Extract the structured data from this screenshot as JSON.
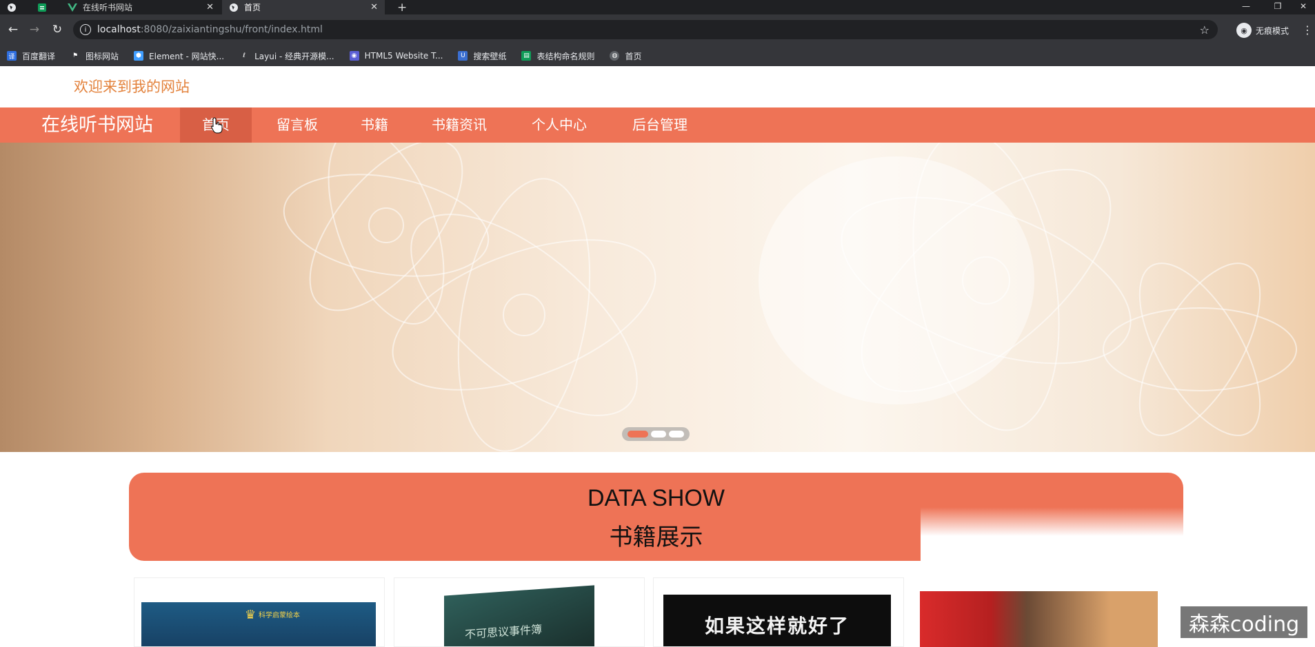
{
  "browser": {
    "tabs": [
      {
        "title": "在线听书网站"
      },
      {
        "title": "首页"
      }
    ],
    "new_tab_symbol": "+",
    "url_host": "localhost",
    "url_rest": ":8080/zaixiantingshu/front/index.html",
    "incognito_label": "无痕模式",
    "bookmarks": [
      {
        "label": "百度翻译",
        "color": "#2f6fe0"
      },
      {
        "label": "图标网站",
        "color": "#222222"
      },
      {
        "label": "Element - 网站快...",
        "color": "#409eff"
      },
      {
        "label": "Layui - 经典开源模...",
        "color": "#35363a"
      },
      {
        "label": "HTML5 Website T...",
        "color": "#5b5fd6"
      },
      {
        "label": "搜索壁纸",
        "color": "#3b6fd1"
      },
      {
        "label": "表结构命名规则",
        "color": "#0f9d58"
      },
      {
        "label": "首页",
        "color": "#5f6368"
      }
    ]
  },
  "site": {
    "welcome": "欢迎来到我的网站",
    "brand": "在线听书网站",
    "nav": [
      "首页",
      "留言板",
      "书籍",
      "书籍资讯",
      "个人中心",
      "后台管理"
    ],
    "active_nav": "首页",
    "accent": "#ee7356",
    "section_title_en": "DATA SHOW",
    "section_title_cn": "书籍展示",
    "carousel_dots": 3,
    "carousel_active": 1
  },
  "book_covers": [
    {
      "text": "科学启蒙绘本",
      "icon": "crown-icon"
    },
    {
      "text": "不可思议事件簿",
      "icon": "book-icon"
    },
    {
      "text": "如果这样就好了",
      "icon": "book-icon"
    },
    {
      "text": "",
      "icon": "book-icon"
    }
  ],
  "watermark": "森森coding"
}
